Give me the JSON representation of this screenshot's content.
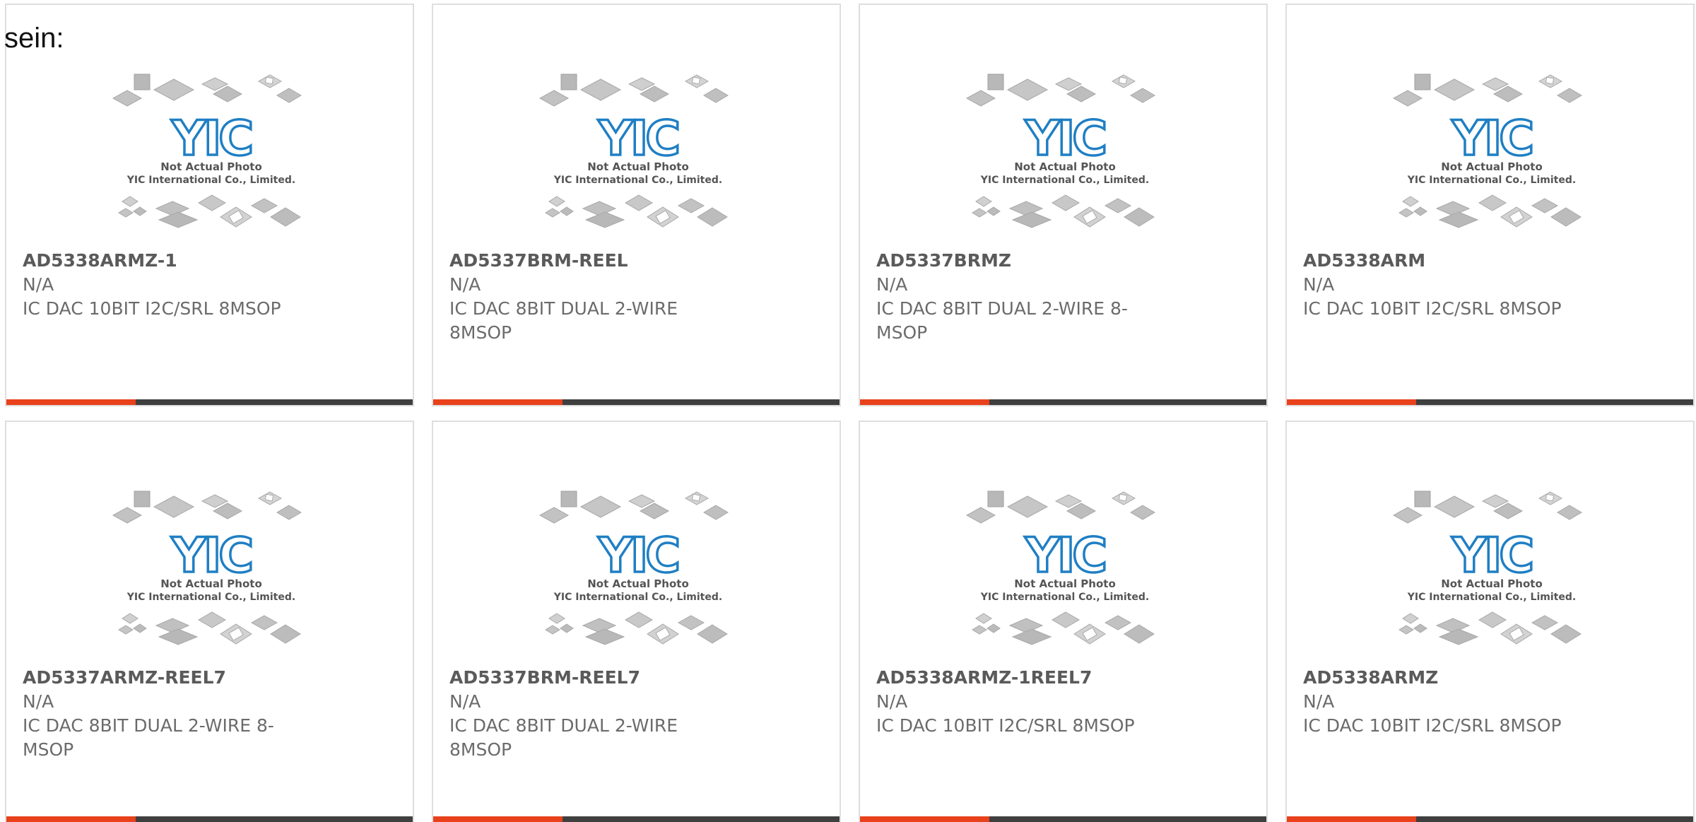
{
  "intro_text": "sein:",
  "colors": {
    "accent": "#e8411b",
    "bar": "#3f3f3f",
    "logo_blue": "#1f7fc4"
  },
  "image": {
    "logo_text": "YIC",
    "caption_line1": "Not Actual Photo",
    "caption_line2": "YIC International Co., Limited."
  },
  "products": [
    {
      "part": "AD5338ARMZ-1",
      "manufacturer": "N/A",
      "description": "IC DAC 10BIT I2C/SRL 8MSOP"
    },
    {
      "part": "AD5337BRM-REEL",
      "manufacturer": "N/A",
      "description": "IC DAC 8BIT DUAL 2-WIRE 8MSOP"
    },
    {
      "part": "AD5337BRMZ",
      "manufacturer": "N/A",
      "description": "IC DAC 8BIT DUAL 2-WIRE 8-MSOP"
    },
    {
      "part": "AD5338ARM",
      "manufacturer": "N/A",
      "description": "IC DAC 10BIT I2C/SRL 8MSOP"
    },
    {
      "part": "AD5337ARMZ-REEL7",
      "manufacturer": "N/A",
      "description": "IC DAC 8BIT DUAL 2-WIRE 8-MSOP"
    },
    {
      "part": "AD5337BRM-REEL7",
      "manufacturer": "N/A",
      "description": "IC DAC 8BIT DUAL 2-WIRE 8MSOP"
    },
    {
      "part": "AD5338ARMZ-1REEL7",
      "manufacturer": "N/A",
      "description": "IC DAC 10BIT I2C/SRL 8MSOP"
    },
    {
      "part": "AD5338ARMZ",
      "manufacturer": "N/A",
      "description": "IC DAC 10BIT I2C/SRL 8MSOP"
    }
  ]
}
